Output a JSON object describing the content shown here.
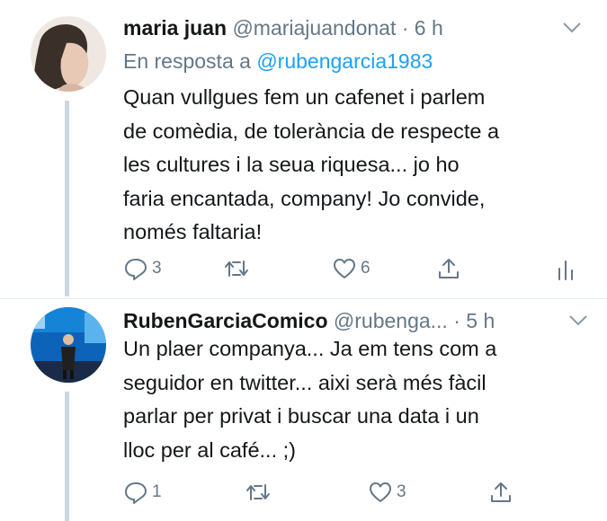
{
  "tweets": [
    {
      "name": "maria juan",
      "handle": "@mariajuandonat",
      "separator": "·",
      "time": "6 h",
      "reply_prefix": "En resposta a",
      "reply_to": "@rubengarcia1983",
      "text": "Quan vullgues fem un cafenet i parlem\nde comèdia, de tolerància de respecte a\nles cultures i la seua riquesa... jo ho\nfaria encantada, company! Jo convide,\nnomés faltaria!",
      "reply_count": "3",
      "like_count": "6"
    },
    {
      "name": "RubenGarciaComico",
      "handle": "@rubenga...",
      "separator": "·",
      "time": "5 h",
      "text": "Un plaer companya... Ja em tens com a\nseguidor en twitter... aixi serà més fàcil\nparlar per privat i buscar una data i un\nlloc per al café... ;)",
      "reply_count": "1",
      "like_count": "3"
    }
  ],
  "icons": {
    "reply": "reply-icon",
    "retweet": "retweet-icon",
    "like": "heart-icon",
    "share": "share-icon",
    "analytics": "analytics-icon",
    "more": "chevron-down-icon"
  },
  "colors": {
    "link": "#1da1f2",
    "secondary": "#657786",
    "thread_line": "#ccd6dd"
  }
}
